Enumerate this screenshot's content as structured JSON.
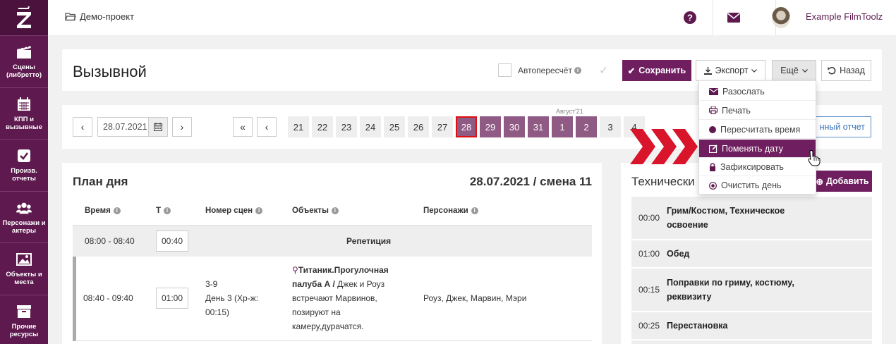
{
  "sidebar": {
    "logo": "Z",
    "items": [
      {
        "label": "Сцены (либретто)",
        "icon": "clapperboard-icon"
      },
      {
        "label": "КПП и вызывные",
        "icon": "calendar-icon"
      },
      {
        "label": "Произв. отчеты",
        "icon": "checkbox-icon"
      },
      {
        "label": "Персонажи и актеры",
        "icon": "users-icon"
      },
      {
        "label": "Объекты и места",
        "icon": "image-icon"
      },
      {
        "label": "Прочие ресурсы",
        "icon": "archive-icon"
      }
    ]
  },
  "topbar": {
    "breadcrumb": "Демо-проект",
    "help_icon": "help-icon",
    "mail_icon": "mail-icon",
    "user_name": "Example FilmToolz"
  },
  "header": {
    "title": "Вызывной",
    "autorecalc_label": "Автопересчёт",
    "save_label": "Сохранить",
    "export_label": "Экспорт",
    "more_label": "Ещё",
    "back_label": "Назад"
  },
  "datebar": {
    "prev": "‹",
    "next": "›",
    "date_value": "28.07.2021",
    "first": "«",
    "prev2": "‹",
    "month_label": "Август'21",
    "days": [
      "21",
      "22",
      "23",
      "24",
      "25",
      "26",
      "27",
      "28",
      "29",
      "30",
      "31",
      "1",
      "2",
      "3",
      "4"
    ],
    "selected_day": "28",
    "report_label": "нный отчет"
  },
  "plan": {
    "title": "План дня",
    "date_shift": "28.07.2021 / смена 11",
    "columns": [
      "Время",
      "Т",
      "Номер сцен",
      "Объекты",
      "Персонажи"
    ],
    "rehearsal": {
      "time": "08:00 - 08:40",
      "duration": "00:40",
      "label": "Репетиция"
    },
    "row": {
      "time": "08:40 - 09:40",
      "duration": "01:00",
      "scene_lines": [
        "3-9",
        "День 3 (Хр-ж:",
        "00:15)"
      ],
      "object_bold1": "Титаник.Прогулочная",
      "object_bold2": "палуба А /",
      "object_text1": " Джек и Роуз",
      "object_text2": "встречают Марвинов,",
      "object_text3": "позируют на",
      "object_text4": "камеру,дурачатся.",
      "characters": "Роуз, Джек, Марвин, Мэри"
    }
  },
  "tech": {
    "title": "Технически",
    "add_label": "Добавить",
    "rows": [
      {
        "time": "00:00",
        "lines": [
          "Грим/Костюм, Техническое",
          "освоение"
        ]
      },
      {
        "time": "01:00",
        "lines": [
          "Обед"
        ]
      },
      {
        "time": "00:15",
        "lines": [
          "Поправки по гриму, костюму,",
          "реквизиту"
        ]
      },
      {
        "time": "00:25",
        "lines": [
          "Перестановка"
        ]
      }
    ]
  },
  "dropdown": {
    "items": [
      {
        "label": "Разослать",
        "icon": "envelope-icon"
      },
      {
        "label": "Печать",
        "icon": "print-icon"
      },
      {
        "label": "Пересчитать время",
        "icon": "circle-icon"
      },
      {
        "label": "Поменять дату",
        "icon": "edit-icon"
      },
      {
        "label": "Зафиксировать",
        "icon": "lock-icon"
      },
      {
        "label": "Очистить день",
        "icon": "clear-icon"
      }
    ],
    "active_index": 3
  },
  "colors": {
    "brand": "#5e1a4f",
    "primary_button": "#6f1e5f",
    "next_days": "#8f5a84",
    "arrow_red": "#d9152b"
  }
}
